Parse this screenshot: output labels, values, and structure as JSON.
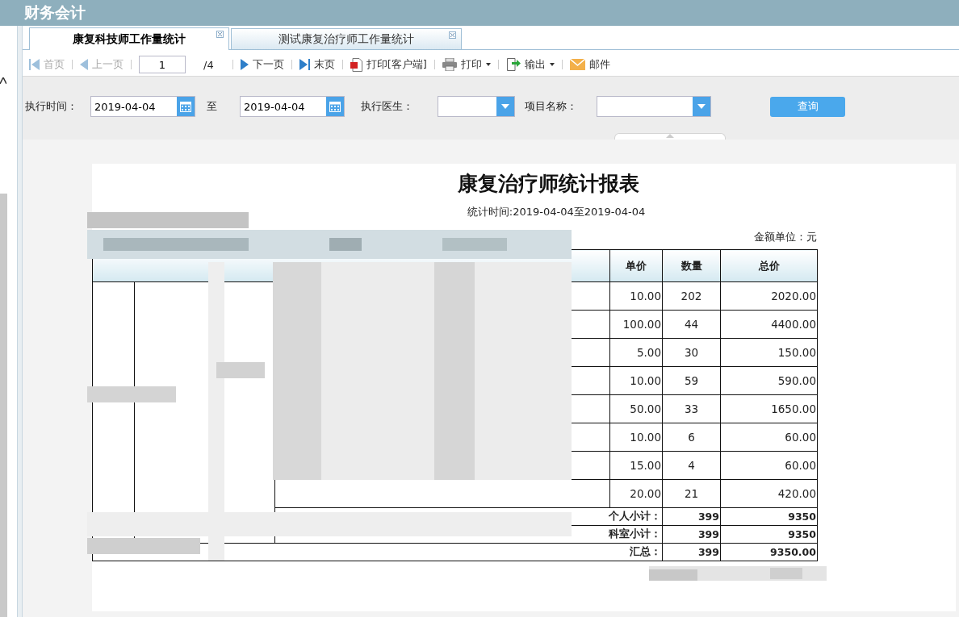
{
  "header": {
    "title": "财务会计"
  },
  "tabs": [
    {
      "label": "康复科技师工作量统计",
      "selected": true
    },
    {
      "label": "测试康复治疗师工作量统计",
      "selected": false
    }
  ],
  "toolbar": [
    {
      "kind": "first",
      "label": "首页",
      "disabled": true
    },
    {
      "kind": "prev",
      "label": "上一页",
      "disabled": true
    },
    {
      "kind": "page",
      "value": "1",
      "total": "/4"
    },
    {
      "kind": "next",
      "label": "下一页",
      "disabled": false
    },
    {
      "kind": "last",
      "label": "末页",
      "disabled": false
    },
    {
      "kind": "print-client",
      "label": "打印[客户端]",
      "disabled": false
    },
    {
      "kind": "print",
      "label": "打印",
      "disabled": false
    },
    {
      "kind": "export",
      "label": "输出",
      "disabled": false
    },
    {
      "kind": "mail",
      "label": "邮件",
      "disabled": false
    }
  ],
  "filters": {
    "time_label": "执行时间：",
    "date_from": "2019-04-04",
    "to_label": "至",
    "date_to": "2019-04-04",
    "doctor_label": "执行医生：",
    "project_label": "项目名称：",
    "query_button": "查询"
  },
  "report": {
    "title": "康复治疗师统计报表",
    "period": "统计时间:2019-04-04至2019-04-04",
    "unit": "金额单位：元",
    "columns": [
      "单价",
      "数量",
      "总价"
    ],
    "rows": [
      [
        "10.00",
        "202",
        "2020.00"
      ],
      [
        "100.00",
        "44",
        "4400.00"
      ],
      [
        "5.00",
        "30",
        "150.00"
      ],
      [
        "10.00",
        "59",
        "590.00"
      ],
      [
        "50.00",
        "33",
        "1650.00"
      ],
      [
        "10.00",
        "6",
        "60.00"
      ],
      [
        "15.00",
        "4",
        "60.00"
      ],
      [
        "20.00",
        "21",
        "420.00"
      ]
    ],
    "summaries": [
      {
        "label": "个人小计：",
        "quantity": "399",
        "total": "9350"
      },
      {
        "label": "科室小计：",
        "quantity": "399",
        "total": "9350"
      },
      {
        "label": "汇总：",
        "quantity": "399",
        "total": "9350.00"
      }
    ]
  }
}
